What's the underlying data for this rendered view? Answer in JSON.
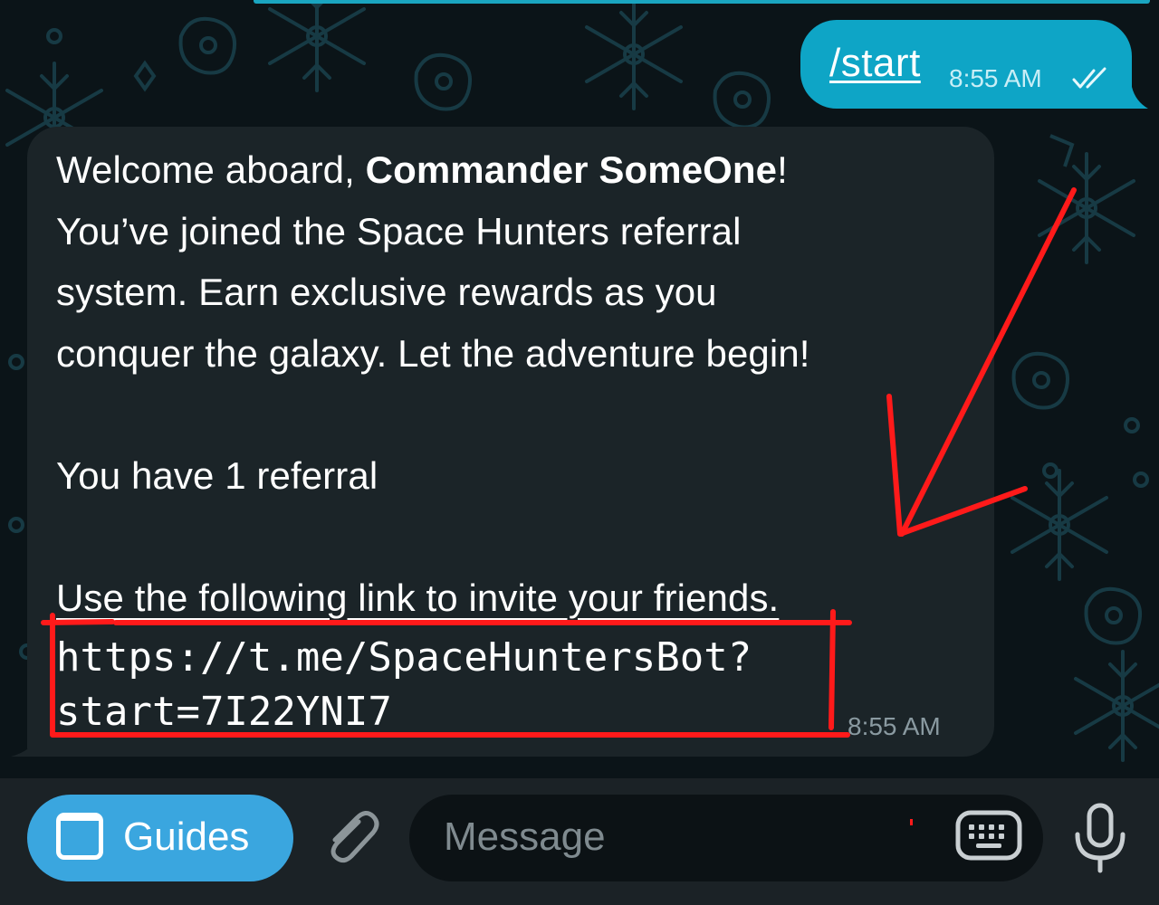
{
  "outgoing_message": {
    "command": "/start",
    "time": "8:55 AM",
    "status": "read-double-check"
  },
  "incoming_message": {
    "welcome_prefix": "Welcome aboard, ",
    "commander_name": "Commander SomeOne",
    "welcome_suffix": "!",
    "line2": "You’ve joined the Space Hunters referral",
    "line3": "system. Earn exclusive rewards as you",
    "line4": "conquer the galaxy. Let the adventure begin!",
    "referral_count_text": "You have 1 referral",
    "invite_text": "Use the following link to invite your friends.",
    "link_part1": "https://t.me/SpaceHuntersBot?",
    "link_part2": "start=7I22YNI7",
    "time": "8:55 AM"
  },
  "annotation": {
    "color": "#ff1a1a",
    "arrow": "pointing-to-referral-link",
    "highlight": "rectangle-around-referral-link"
  },
  "input_bar": {
    "guides_label": "Guides",
    "message_placeholder": "Message",
    "icons": [
      "guides-window-icon",
      "paperclip-icon",
      "keyboard-icon",
      "microphone-icon"
    ]
  },
  "colors": {
    "outgoing_bubble": "#0ea5c6",
    "incoming_bubble": "#1b2428",
    "guides_button": "#3aa6df",
    "background": "#0b1418"
  }
}
